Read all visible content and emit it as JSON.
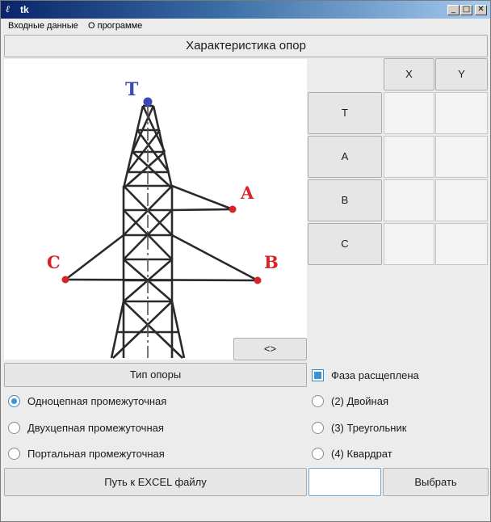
{
  "window": {
    "title": "tk",
    "minimize": "_",
    "maximize": "□",
    "close": "✕"
  },
  "menu": {
    "items": [
      {
        "label": "Входные данные"
      },
      {
        "label": "О программе"
      }
    ]
  },
  "header": {
    "title": "Характеристика опор"
  },
  "diagram": {
    "labels": {
      "t": "T",
      "a": "A",
      "b": "B",
      "c": "C"
    },
    "colors": {
      "top_point": "#3a48b8",
      "phase_point": "#d8232a",
      "structure": "#2a2a2a"
    }
  },
  "swap_button": {
    "label": "<>"
  },
  "table": {
    "col_headers": [
      "X",
      "Y"
    ],
    "row_headers": [
      "T",
      "A",
      "B",
      "C"
    ]
  },
  "support_type": {
    "button_label": "Тип опоры",
    "options": [
      {
        "label": "Одноцепная промежуточная",
        "selected": true
      },
      {
        "label": "Двухцепная промежуточная",
        "selected": false
      },
      {
        "label": "Портальная промежуточная",
        "selected": false
      }
    ]
  },
  "phase": {
    "split_label": "Фаза расщеплена",
    "split_checked": true,
    "options": [
      {
        "label": "(2) Двойная",
        "selected": false
      },
      {
        "label": "(3) Треугольник",
        "selected": false
      },
      {
        "label": "(4) Квардрат",
        "selected": false
      }
    ]
  },
  "excel": {
    "path_label": "Путь к EXCEL файлу",
    "path_value": "",
    "choose_label": "Выбрать"
  },
  "accent_color": "#3a93d5"
}
